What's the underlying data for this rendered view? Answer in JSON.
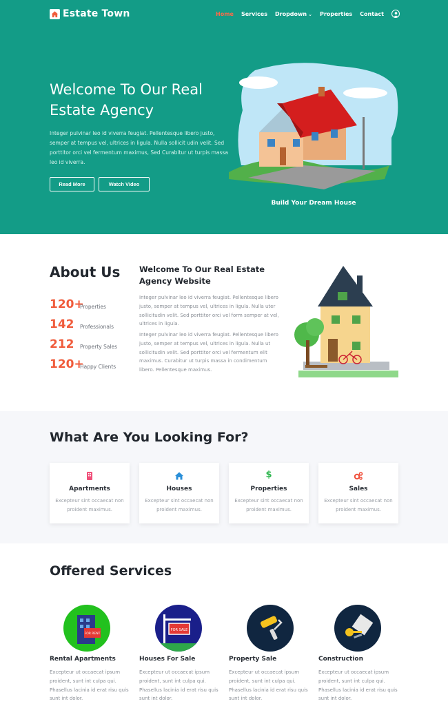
{
  "brand": {
    "name": "Estate Town"
  },
  "nav": {
    "items": [
      "Home",
      "Services",
      "Dropdown",
      "Properties",
      "Contact"
    ],
    "active": "Home"
  },
  "hero": {
    "title": "Welcome To Our Real Estate Agency",
    "text": "Integer pulvinar leo id viverra feugiat. Pellentesque libero justo, semper at tempus vel, ultrices in ligula. Nulla sollicit udin velit. Sed porttitor orci vel fermentum maximus, Sed Curabitur ut turpis massa leo id viverra.",
    "read_more": "Read More",
    "watch_video": "Watch Video",
    "caption": "Build Your Dream House"
  },
  "about": {
    "title": "About Us",
    "stats": [
      {
        "number": "120+",
        "label": "Properties"
      },
      {
        "number": "142",
        "label": "Professionals"
      },
      {
        "number": "212",
        "label": "Property Sales"
      },
      {
        "number": "120+",
        "label": "Happy Clients"
      }
    ],
    "heading": "Welcome To Our Real Estate Agency Website",
    "para1": "Integer pulvinar leo id viverra feugiat. Pellentesque libero justo, semper at tempus vel, ultrices in ligula. Nulla uter sollicitudin velit. Sed porttitor orci vel form semper at vel, ultrices in ligula.",
    "para2": "Integer pulvinar leo id viverra feugiat. Pellentesque libero justo, semper at tempus vel, ultrices in ligula. Nulla ut sollicitudin velit. Sed porttitor orci vel fermentum elit maximus. Curabitur ut turpis massa in condimentum libero. Pellentesque maximus."
  },
  "looking": {
    "title": "What Are You Looking For?",
    "cards": [
      {
        "title": "Apartments",
        "text": "Excepteur sint occaecat non proident maximus.",
        "icon": "apartment-icon"
      },
      {
        "title": "Houses",
        "text": "Excepteur sint occaecat non proident maximus.",
        "icon": "home-icon"
      },
      {
        "title": "Properties",
        "text": "Excepteur sint occaecat non proident maximus.",
        "icon": "dollar-icon"
      },
      {
        "title": "Sales",
        "text": "Excepteur sint occaecat non proident maximus.",
        "icon": "gears-icon"
      }
    ]
  },
  "services": {
    "title": "Offered Services",
    "items": [
      {
        "title": "Rental Apartments",
        "text": "Excepteur ut occaecat ipsum proident, sunt int culpa qui. Phasellus lacinia id erat risu quis sunt int dolor."
      },
      {
        "title": "Houses For Sale",
        "text": "Excepteur ut occaecat ipsum proident, sunt int culpa qui. Phasellus lacinia id erat risu quis sunt int dolor."
      },
      {
        "title": "Property Sale",
        "text": "Excepteur ut occaecat ipsum proident, sunt int culpa qui. Phasellus lacinia id erat risu quis sunt int dolor."
      },
      {
        "title": "Construction",
        "text": "Excepteur ut occaecat ipsum proident, sunt int culpa qui. Phasellus lacinia id erat risu quis sunt int dolor."
      }
    ],
    "signs": {
      "for_rent": "FOR RENT",
      "for_sale": "FOR SALE"
    }
  },
  "colors": {
    "primary": "#139c87",
    "accent": "#f05c3c",
    "light_bg": "#f6f7fa"
  }
}
